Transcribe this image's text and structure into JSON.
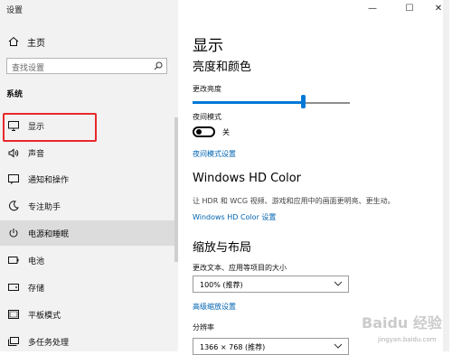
{
  "window": {
    "title": "设置",
    "minimize_glyph": "—",
    "maximize_glyph": "☐",
    "close_glyph": "✕"
  },
  "sidebar": {
    "home_label": "主页",
    "search_placeholder": "查找设置",
    "section_label": "系统",
    "items": [
      {
        "label": "显示",
        "icon": "monitor-icon"
      },
      {
        "label": "声音",
        "icon": "speaker-icon"
      },
      {
        "label": "通知和操作",
        "icon": "notification-icon"
      },
      {
        "label": "专注助手",
        "icon": "moon-icon"
      },
      {
        "label": "电源和睡眠",
        "icon": "power-icon"
      },
      {
        "label": "电池",
        "icon": "battery-icon"
      },
      {
        "label": "存储",
        "icon": "storage-icon"
      },
      {
        "label": "平板模式",
        "icon": "tablet-icon"
      },
      {
        "label": "多任务处理",
        "icon": "multitask-icon"
      }
    ],
    "highlight_color": "#e8282b"
  },
  "main": {
    "title": "显示",
    "brightness_section": "亮度和颜色",
    "brightness_label": "更改亮度",
    "brightness_level_percent": 70,
    "night_light_label": "夜间模式",
    "night_light_state": "关",
    "night_light_link": "夜间模式设置",
    "hdr_section": "Windows HD Color",
    "hdr_desc": "让 HDR 和 WCG 视频、游戏和应用中的画面更明亮、更生动。",
    "hdr_link": "Windows HD Color 设置",
    "scale_section": "缩放与布局",
    "scale_label": "更改文本、应用等项目的大小",
    "scale_value": "100% (推荐)",
    "advanced_scale_link": "高级缩放设置",
    "resolution_label": "分辨率",
    "resolution_value": "1366 × 768 (推荐)"
  },
  "colors": {
    "accent": "#0078d7",
    "link": "#0063b1"
  },
  "watermark": {
    "text": "Baidu 经验",
    "sub": "jingyan.baidu.com"
  }
}
